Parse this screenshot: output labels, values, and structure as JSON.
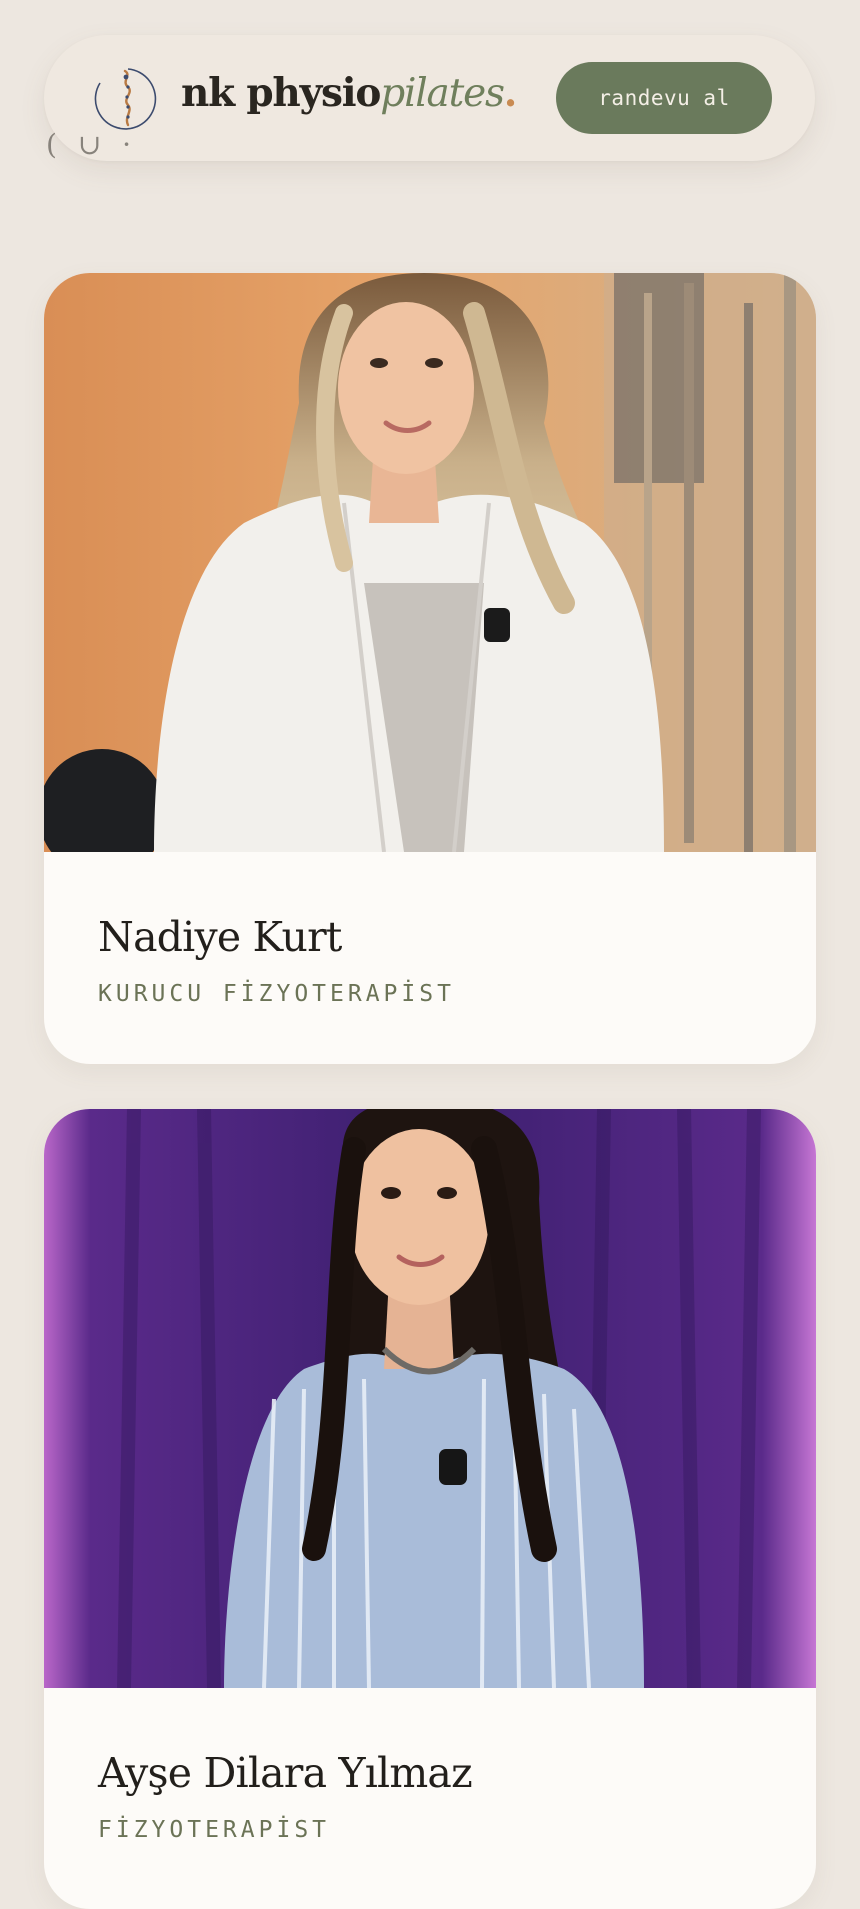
{
  "header": {
    "brand_main": "nk physio",
    "brand_accent": "pilates",
    "brand_dot": ".",
    "cta_label": "randevu al",
    "logo_icon": "spine-circle-logo-icon"
  },
  "team": [
    {
      "name": "Nadiye Kurt",
      "role": "KURUCU FİZYOTERAPİST",
      "photo_icon": "portrait-photo"
    },
    {
      "name": "Ayşe Dilara Yılmaz",
      "role": "FİZYOTERAPİST",
      "photo_icon": "portrait-photo"
    }
  ],
  "colors": {
    "background": "#ede7e0",
    "accent_green": "#6a7a5c",
    "brand_accent": "#6f7f5c",
    "text_dark": "#221f1b",
    "card": "#fdfbf8"
  }
}
